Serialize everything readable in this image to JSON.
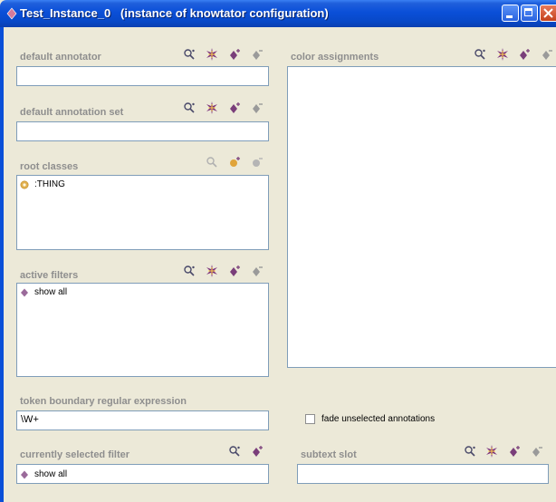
{
  "window": {
    "title": "Test_Instance_0   (instance of knowtator configuration)"
  },
  "default_annotator": {
    "label": "default annotator",
    "value": ""
  },
  "default_annotation_set": {
    "label": "default annotation set",
    "value": ""
  },
  "root_classes": {
    "label": "root classes",
    "items": [
      ":THING"
    ]
  },
  "active_filters": {
    "label": "active filters",
    "items": [
      "show all"
    ]
  },
  "color_assignments": {
    "label": "color assignments"
  },
  "token_boundary": {
    "label": "token boundary regular expression",
    "value": "\\W+"
  },
  "fade_option": {
    "label": "fade unselected annotations",
    "checked": false
  },
  "currently_selected_filter": {
    "label": "currently selected filter",
    "value": "show all"
  },
  "subtext_slot": {
    "label": "subtext slot",
    "value": ""
  },
  "colors": {
    "title_bar": "#0a4fd8",
    "label_gray": "#8e8e8e",
    "instance_icon": "#7a3e7a",
    "class_icon": "#d9a441"
  }
}
